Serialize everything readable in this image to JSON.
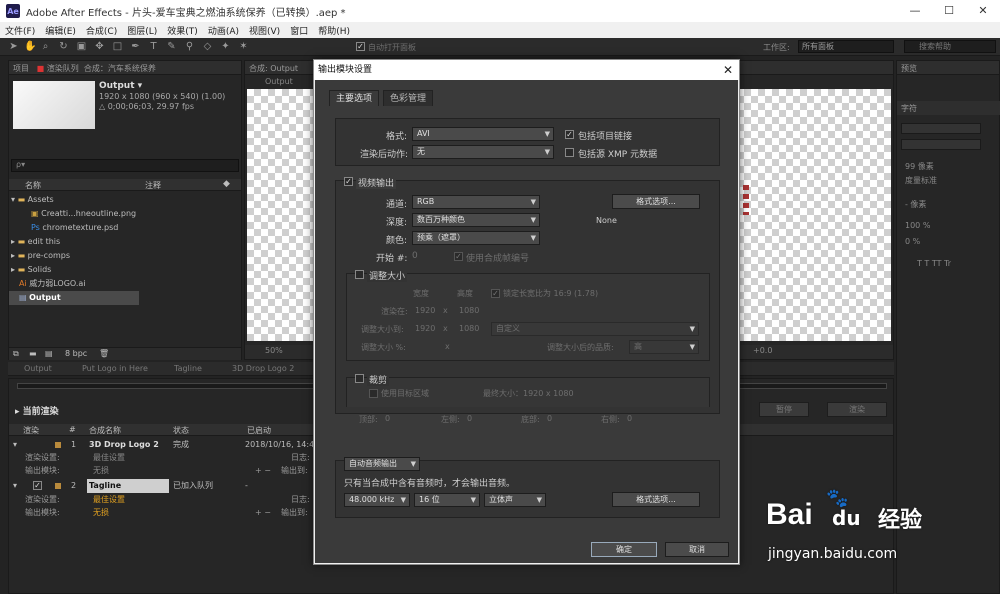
{
  "window": {
    "title": "Adobe After Effects - 片头-爱车宝典之燃油系统保养（已转换）.aep *",
    "app_icon": "Ae",
    "minimize": "—",
    "maximize": "☐",
    "close": "✕"
  },
  "menu": [
    "文件(F)",
    "编辑(E)",
    "合成(C)",
    "图层(L)",
    "效果(T)",
    "动画(A)",
    "视图(V)",
    "窗口",
    "帮助(H)"
  ],
  "toolbar": {
    "auto_open": "自动打开面板",
    "workspace_label": "工作区:",
    "workspace_value": "所有面板",
    "search_placeholder": "搜索帮助"
  },
  "project": {
    "tabs": [
      "项目",
      "渲染队列",
      "合成：汽车系统保养"
    ],
    "item_name": "Output ▾",
    "item_info1": "1920 x 1080  (960 x 540) (1.00)",
    "item_info2": "△ 0;00;06;03, 29.97 fps",
    "search": "ρ▾",
    "col_name": "名称",
    "col_note": "注释",
    "items": [
      {
        "name": "Assets",
        "kind": "folder"
      },
      {
        "name": "Creatti...hneoutline.png",
        "kind": "png"
      },
      {
        "name": "chrometexture.psd",
        "kind": "psd"
      },
      {
        "name": "edit this",
        "kind": "folder"
      },
      {
        "name": "pre-comps",
        "kind": "folder"
      },
      {
        "name": "Solids",
        "kind": "folder"
      },
      {
        "name": "威力弱LOGO.ai",
        "kind": "ai"
      },
      {
        "name": "Output",
        "kind": "comp"
      }
    ],
    "bpc": "8 bpc"
  },
  "comp": {
    "tab": "合成: Output",
    "sub": "Output",
    "zoom": "50%",
    "offset": "+0.0"
  },
  "timeline_tabs": [
    "Output",
    "Put Logo in Here",
    "Tagline",
    "3D Drop Logo 2"
  ],
  "render": {
    "current": "当前渲染",
    "stop": "暂停",
    "render_btn": "渲染",
    "cols": [
      "渲染",
      "#",
      "合成名称",
      "状态",
      "已启动"
    ],
    "item1": {
      "num": "1",
      "name": "3D Drop Logo 2",
      "status": "完成",
      "started": "2018/10/16, 14:43:25",
      "settings_label": "渲染设置:",
      "settings": "最佳设置",
      "module_label": "输出模块:",
      "module": "无损",
      "log": "日志:",
      "out": "输出到:"
    },
    "item2": {
      "num": "2",
      "name": "Tagline",
      "status": "已加入队列",
      "started": "-",
      "settings_label": "渲染设置:",
      "settings": "最佳设置",
      "module_label": "输出模块:",
      "module": "无损",
      "log": "日志:",
      "out": "输出到:"
    }
  },
  "right_panels": {
    "tab1": "预览",
    "tab2": "字符",
    "px": "99 像素",
    "track": "度量标准",
    "px2": "- 像素",
    "pct": "100 %",
    "pct2": "0 %",
    "styles": "T  T  TT  Tr"
  },
  "dialog": {
    "title": "输出模块设置",
    "close": "✕",
    "tabs": [
      "主要选项",
      "色彩管理"
    ],
    "format_label": "格式:",
    "format_value": "AVI",
    "include_link": "包括项目链接",
    "post_label": "渲染后动作:",
    "post_value": "无",
    "include_xmp": "包括源 XMP 元数据",
    "video_output": "视频输出",
    "channel_label": "通道:",
    "channel_value": "RGB",
    "format_options": "格式选项...",
    "depth_label": "深度:",
    "depth_value": "数百万种颜色",
    "codec": "None",
    "color_label": "颜色:",
    "color_value": "预乘（遮罩）",
    "start_label": "开始 #:",
    "start_value": "0",
    "use_comp_frame": "使用合成帧编号",
    "resize": "调整大小",
    "width": "宽度",
    "height": "高度",
    "lock_ratio": "锁定长宽比为 16:9 (1.78)",
    "render_at": "渲染在:",
    "render_w": "1920",
    "render_h": "1080",
    "x": "x",
    "resize_to": "调整大小到:",
    "resize_w": "1920",
    "resize_h": "1080",
    "custom": "自定义",
    "resize_pct": "调整大小 %:",
    "quality_label": "调整大小后的品质:",
    "quality_value": "高",
    "crop": "裁剪",
    "use_roi": "使用目标区域",
    "final_size": "最终大小：1920 x 1080",
    "top": "顶部:",
    "top_v": "0",
    "left": "左侧:",
    "left_v": "0",
    "bottom": "底部:",
    "bottom_v": "0",
    "right": "右侧:",
    "right_v": "0",
    "audio_auto": "自动音频输出",
    "audio_note": "只有当合成中含有音频时，才会输出音频。",
    "rate": "48.000 kHz",
    "bits": "16 位",
    "stereo": "立体声",
    "audio_options": "格式选项...",
    "ok": "确定",
    "cancel": "取消"
  },
  "watermark": {
    "brand": "Bai",
    "paw": "du",
    "cn": "经验",
    "url": "jingyan.baidu.com"
  }
}
